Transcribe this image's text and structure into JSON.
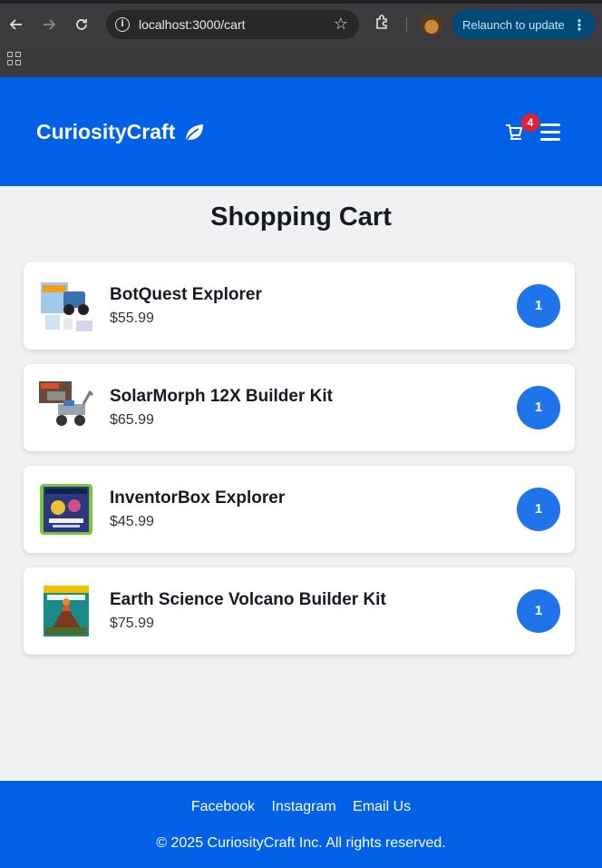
{
  "browser": {
    "url": "localhost:3000/cart",
    "relaunch_label": "Relaunch to update"
  },
  "header": {
    "brand": "CuriosityCraft",
    "cart_count": "4",
    "brand_color": "#0060e6"
  },
  "main": {
    "title": "Shopping Cart",
    "items": [
      {
        "name": "BotQuest Explorer",
        "price": "$55.99",
        "quantity": "1",
        "image": "robot-kit-box"
      },
      {
        "name": "SolarMorph 12X Builder Kit",
        "price": "$65.99",
        "quantity": "1",
        "image": "solar-robot-kit"
      },
      {
        "name": "InventorBox Explorer",
        "price": "$45.99",
        "quantity": "1",
        "image": "inventor-box"
      },
      {
        "name": "Earth Science Volcano Builder Kit",
        "price": "$75.99",
        "quantity": "1",
        "image": "volcano-kit-box"
      }
    ]
  },
  "footer": {
    "links": [
      "Facebook",
      "Instagram",
      "Email Us"
    ],
    "copyright": "© 2025 CuriosityCraft Inc. All rights reserved."
  },
  "colors": {
    "accent": "#1f74ea",
    "badge": "#e5202e"
  }
}
